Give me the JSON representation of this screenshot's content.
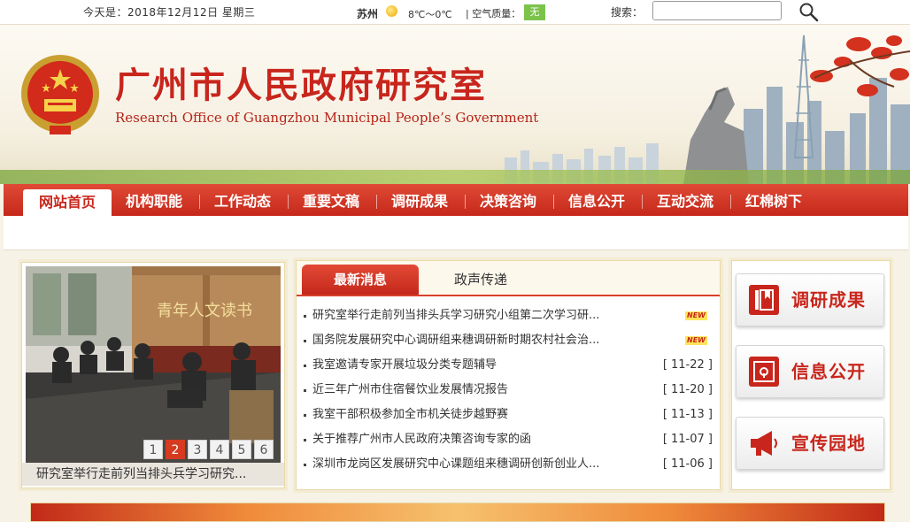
{
  "topbar": {
    "date": "今天是：2018年12月12日  星期三",
    "city": "苏州",
    "weather_icon": "sun-icon",
    "temperature": "8℃～0℃",
    "aqi_label": "| 空气质量：",
    "aqi_value": "无",
    "aqi_color": "#7cc34c",
    "search_label": "搜索：",
    "search_value": "",
    "search_icon": "magnifier-icon"
  },
  "header": {
    "title": "广州市人民政府研究室",
    "subtitle": "Research Office of Guangzhou Municipal People’s Government",
    "brand_color": "#c8261c"
  },
  "nav": {
    "items": [
      "网站首页",
      "机构职能",
      "工作动态",
      "重要文稿",
      "调研成果",
      "决策咨询",
      "信息公开",
      "互动交流",
      "红棉树下"
    ],
    "active": "网站首页"
  },
  "slideshow": {
    "caption": "研究室举行走前列当排头兵学习研究...",
    "pages": [
      "1",
      "2",
      "3",
      "4",
      "5",
      "6"
    ],
    "current_page": "2",
    "banner_text": "青年人文读书"
  },
  "news": {
    "tabs": [
      "最新消息",
      "政声传递"
    ],
    "active_tab": "最新消息",
    "items": [
      {
        "title": "研究室举行走前列当排头兵学习研究小组第二次学习研...",
        "date": "",
        "badge": "NEW"
      },
      {
        "title": "国务院发展研究中心调研组来穗调研新时期农村社会治...",
        "date": "",
        "badge": "NEW"
      },
      {
        "title": "我室邀请专家开展垃圾分类专题辅导",
        "date": "[ 11-22 ]",
        "badge": ""
      },
      {
        "title": "近三年广州市住宿餐饮业发展情况报告",
        "date": "[ 11-20 ]",
        "badge": ""
      },
      {
        "title": "我室干部积极参加全市机关徒步越野赛",
        "date": "[ 11-13 ]",
        "badge": ""
      },
      {
        "title": "关于推荐广州市人民政府决策咨询专家的函",
        "date": "[ 11-07 ]",
        "badge": ""
      },
      {
        "title": "深圳市龙岗区发展研究中心课题组来穗调研创新创业人...",
        "date": "[ 11-06 ]",
        "badge": ""
      }
    ]
  },
  "side": {
    "buttons": [
      {
        "label": "调研成果",
        "icon": "book-icon"
      },
      {
        "label": "信息公开",
        "icon": "safe-icon"
      },
      {
        "label": "宣传园地",
        "icon": "megaphone-icon"
      }
    ]
  }
}
